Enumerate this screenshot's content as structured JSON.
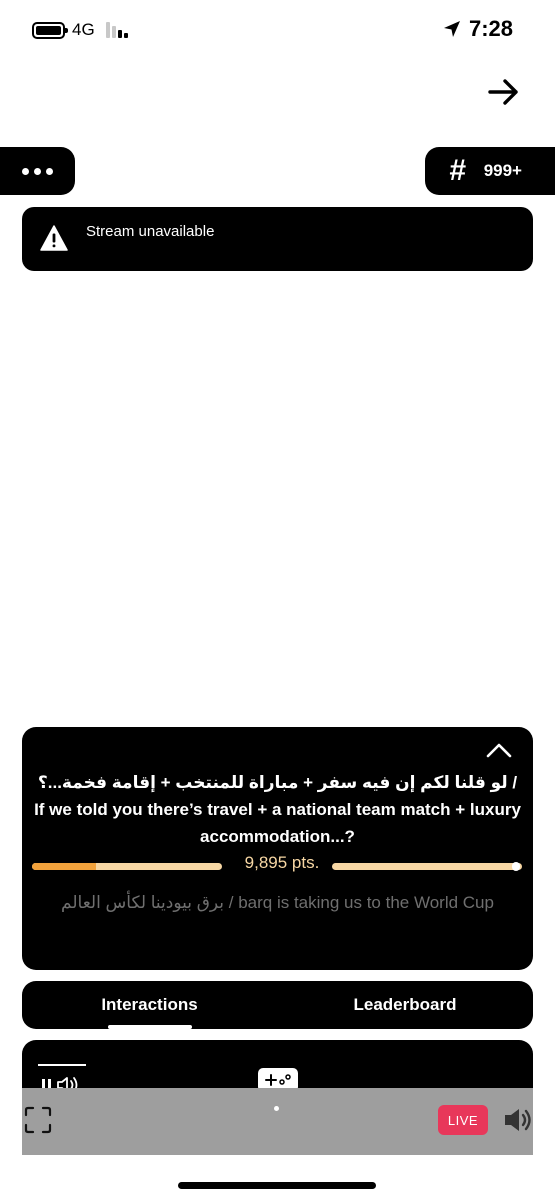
{
  "status_bar": {
    "network": "4G",
    "time": "7:28",
    "icons": [
      "battery-icon",
      "signal-bars-icon",
      "location-arrow-icon"
    ]
  },
  "header": {
    "back_icon": "arrow-right-icon",
    "menu_icon": "more-dots-icon",
    "hash_icon": "#",
    "count": "999+"
  },
  "alert": {
    "icon": "warning-triangle-icon",
    "text": "Stream unavailable"
  },
  "question": {
    "collapse_icon": "chevron-up-icon",
    "text": "لو قلنا لكم إن فيه سفر + مباراة للمنتخب + إقامة فخمة...؟ / If we told you there’s travel + a national team match + luxury accommodation...?",
    "points_label": "9,895 pts.",
    "progress_fraction": 0.13,
    "prize_text": "برق بيودينا لكأس العالم / barq is taking us to the World Cup",
    "colors": {
      "fill": "#f2a23c",
      "track": "#f7d7a4"
    }
  },
  "tabs": [
    {
      "label": "Interactions",
      "active": true
    },
    {
      "label": "Leaderboard",
      "active": false
    }
  ],
  "player": {
    "pause_icon": "pause-icon",
    "sound_icon": "sound-icon",
    "gamepad_icon": "gamepad-icon",
    "fullscreen_icon": "fullscreen-icon",
    "live_label": "LIVE",
    "speaker_icon": "speaker-icon",
    "colors": {
      "live": "#e8375a"
    }
  }
}
